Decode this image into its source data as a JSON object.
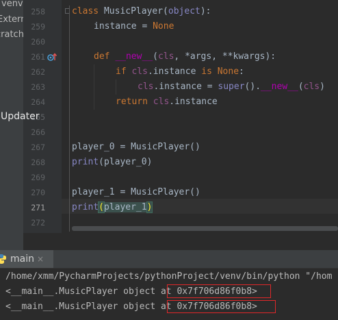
{
  "project_panel": {
    "items": [
      "venv",
      "Externa",
      "cratch"
    ],
    "updater_label": "Updater"
  },
  "editor": {
    "line_numbers": [
      "258",
      "259",
      "260",
      "261",
      "262",
      "263",
      "264",
      "265",
      "266",
      "267",
      "268",
      "269",
      "270",
      "271",
      "272"
    ],
    "current_line": "271",
    "code": {
      "l258": [
        "class",
        " MusicPlayer(",
        "object",
        "):"
      ],
      "l259": [
        "instance",
        " = ",
        "None"
      ],
      "l261": [
        "def",
        " ",
        "__new__",
        "(",
        "cls",
        ", *args, **kwargs):"
      ],
      "l262": [
        "if",
        " ",
        "cls",
        ".instance ",
        "is",
        " ",
        "None",
        ":"
      ],
      "l263": [
        "cls",
        ".instance = ",
        "super",
        "().",
        "__new__",
        "(",
        "cls",
        ")"
      ],
      "l264": [
        "return",
        " ",
        "cls",
        ".instance"
      ],
      "l267": [
        "player_0 = MusicPlayer()"
      ],
      "l268": [
        "print",
        "(player_0)"
      ],
      "l270": [
        "player_1 = MusicPlayer()"
      ],
      "l271": [
        "print",
        "(",
        "player_1",
        ")"
      ]
    }
  },
  "run_panel": {
    "tab_label": "main",
    "close_glyph": "×",
    "output": [
      "/home/xmm/PycharmProjects/pythonProject/venv/bin/python \"/hom",
      "<__main__.MusicPlayer object at 0x7f706d86f0b8>",
      "<__main__.MusicPlayer object at 0x7f706d86f0b8>"
    ]
  },
  "icons": {
    "override": "override-up-arrow-icon",
    "python": "python-icon",
    "fold": "fold-marker-icon"
  },
  "colors": {
    "keyword": "#cc7832",
    "self_param": "#94558d",
    "magic": "#b200b2",
    "builtin": "#8888c6",
    "highlight_box": "#e0282a"
  }
}
